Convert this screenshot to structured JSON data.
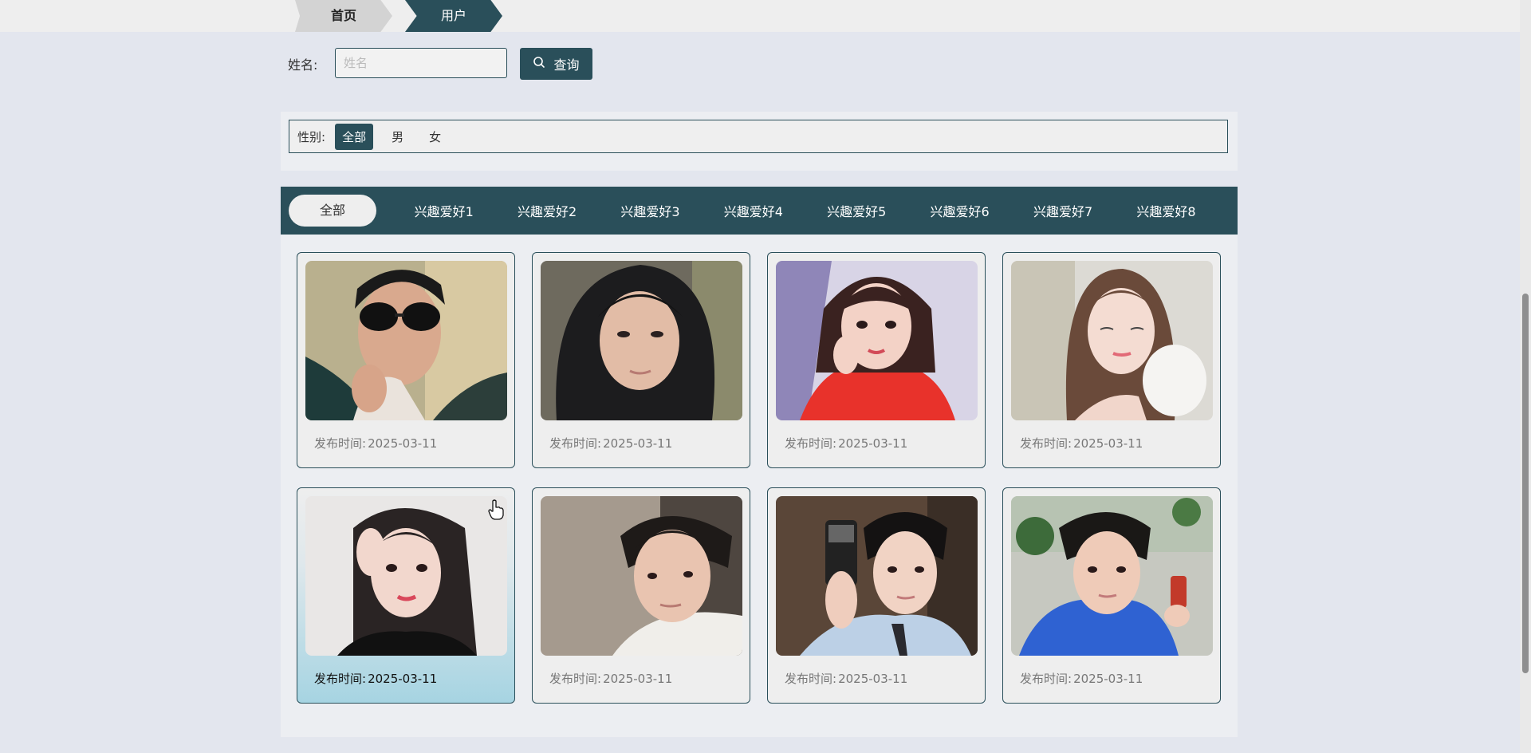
{
  "breadcrumb": {
    "home": "首页",
    "current": "用户"
  },
  "search": {
    "label": "姓名:",
    "placeholder": "姓名",
    "value": "",
    "button_label": "查询"
  },
  "gender_filter": {
    "label": "性别:",
    "options": [
      "全部",
      "男",
      "女"
    ],
    "selected": "全部"
  },
  "hobby_tabs": [
    "全部",
    "兴趣爱好1",
    "兴趣爱好2",
    "兴趣爱好3",
    "兴趣爱好4",
    "兴趣爱好5",
    "兴趣爱好6",
    "兴趣爱好7",
    "兴趣爱好8"
  ],
  "cards": [
    {
      "date_label": "发布时间:",
      "date": "2025-03-11"
    },
    {
      "date_label": "发布时间:",
      "date": "2025-03-11"
    },
    {
      "date_label": "发布时间:",
      "date": "2025-03-11"
    },
    {
      "date_label": "发布时间:",
      "date": "2025-03-11"
    },
    {
      "date_label": "发布时间:",
      "date": "2025-03-11"
    },
    {
      "date_label": "发布时间:",
      "date": "2025-03-11"
    },
    {
      "date_label": "发布时间:",
      "date": "2025-03-11"
    },
    {
      "date_label": "发布时间:",
      "date": "2025-03-11"
    }
  ],
  "colors": {
    "primary": "#2a4f5a",
    "background": "#e3e6ee",
    "hover_card": "#a6d4e2"
  },
  "icons": {
    "search_button": "search-icon",
    "mouse": "pointer-hand-icon"
  }
}
